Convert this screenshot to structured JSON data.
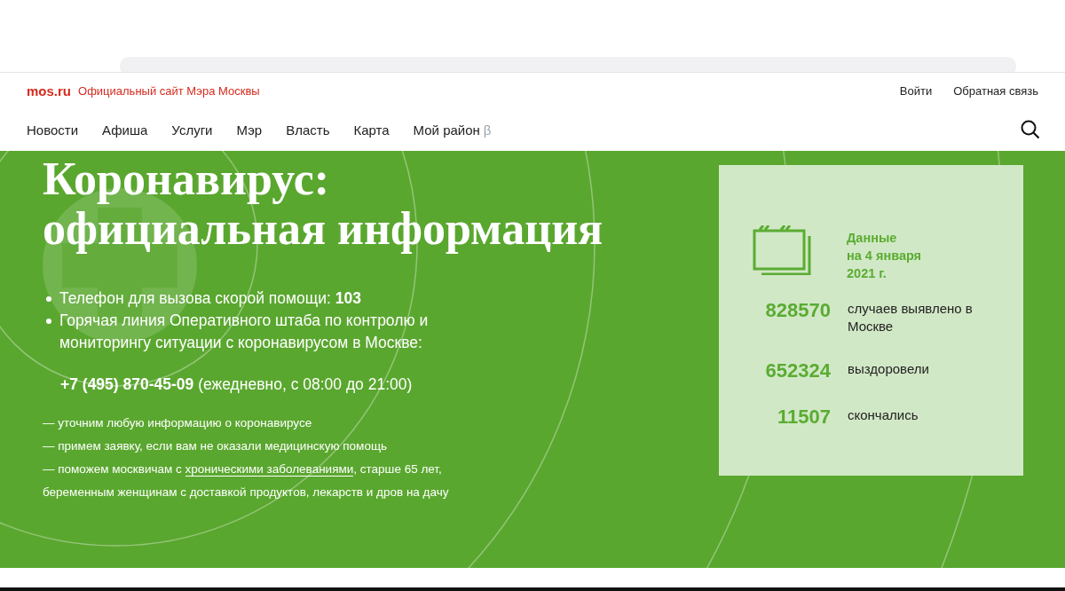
{
  "header": {
    "logo": "mos.ru",
    "tagline": "Официальный сайт Мэра Москвы",
    "links": [
      "Войти",
      "Обратная связь"
    ]
  },
  "nav": [
    {
      "label": "Новости"
    },
    {
      "label": "Афиша"
    },
    {
      "label": "Услуги"
    },
    {
      "label": "Мэр"
    },
    {
      "label": "Власть"
    },
    {
      "label": "Карта"
    },
    {
      "label": "Мой район",
      "badge": "β"
    }
  ],
  "hero": {
    "title_lines": [
      "Коронавирус:",
      "официальная информация"
    ],
    "bullets": [
      "Телефон для вызова скорой помощи: **103**",
      "Горячая линия Оперативного штаба по контролю и мониторингу ситуации с коронавирусом в Москве:"
    ],
    "phone": "**+7 (495) 870-45-09** (ежедневно, с 08:00 до 21:00)",
    "services": [
      {
        "text": "— уточним любую информацию о коронавирусе"
      },
      {
        "text": "— примем заявку, если вам не оказали медицинскую помощь"
      },
      {
        "text": "— поможем москвичам с ",
        "link": "хроническими заболеваниями",
        "after": ", старше 65 лет, беременным женщинам с доставкой продуктов, лекарств и дров на дачу"
      }
    ]
  },
  "stats": {
    "date_lines": [
      "Данные",
      "на 4 января",
      "2021 г."
    ],
    "items": [
      {
        "value": "828570",
        "label": "случаев выявлено в Москве"
      },
      {
        "value": "652324",
        "label": "выздоровели"
      },
      {
        "value": "11507",
        "label": "скончались"
      }
    ]
  }
}
